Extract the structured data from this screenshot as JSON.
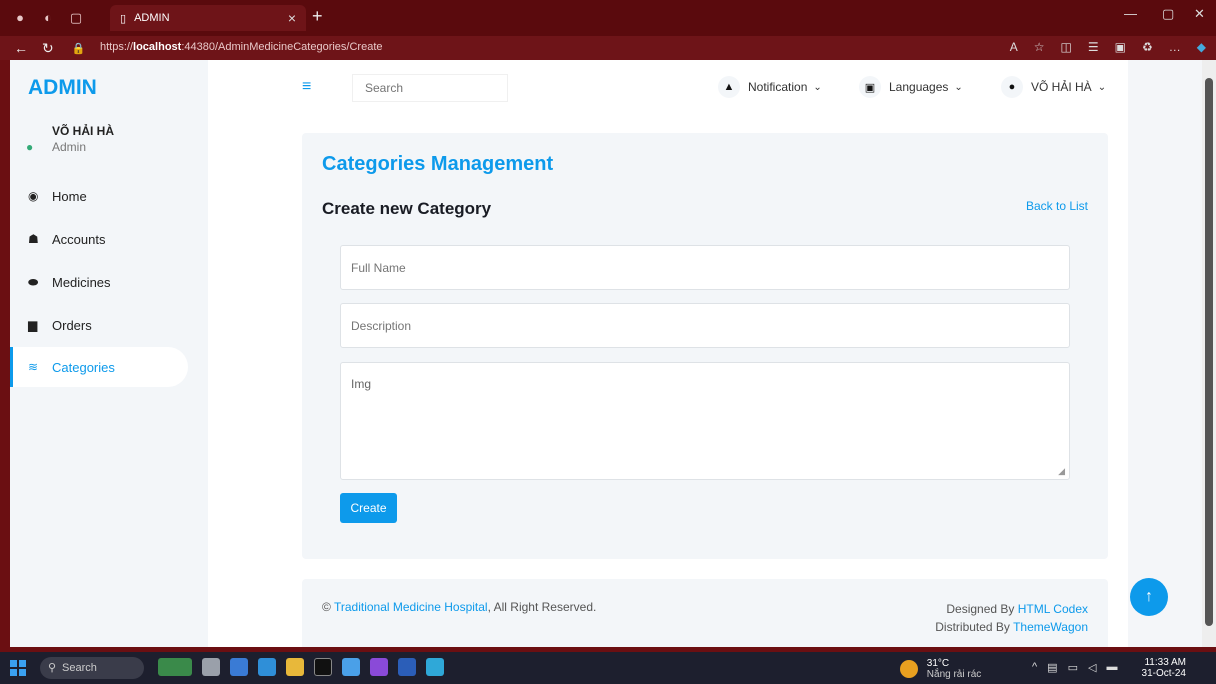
{
  "browser": {
    "tab_title": "ADMIN",
    "new_tab": "+",
    "url_prefix": "https://",
    "url_host": "localhost",
    "url_rest": ":44380/AdminMedicineCategories/Create"
  },
  "sidebar": {
    "brand": "ADMIN",
    "user_name": "VÕ HẢI HÀ",
    "user_role": "Admin",
    "items": [
      {
        "label": "Home",
        "icon": "dashboard-icon"
      },
      {
        "label": "Accounts",
        "icon": "users-icon"
      },
      {
        "label": "Medicines",
        "icon": "pills-icon"
      },
      {
        "label": "Orders",
        "icon": "file-icon"
      },
      {
        "label": "Categories",
        "icon": "layers-icon"
      }
    ],
    "active_item": "Categories"
  },
  "topbar": {
    "search_placeholder": "Search",
    "notification_label": "Notification",
    "languages_label": "Languages",
    "user_label": "VÕ HẢI HÀ"
  },
  "card": {
    "title": "Categories Management",
    "subtitle": "Create new Category",
    "back_link": "Back to List",
    "fields": {
      "full_name_placeholder": "Full Name",
      "description_placeholder": "Description",
      "img_placeholder": "Img"
    },
    "create_button": "Create"
  },
  "footer": {
    "copyright_symbol": "©",
    "hospital_link": "Traditional Medicine Hospital",
    "rights": ", All Right Reserved.",
    "designed_by": "Designed By",
    "designer_link": "HTML Codex",
    "distributed_by": "Distributed By",
    "distributor_link": "ThemeWagon"
  },
  "taskbar": {
    "search_label": "Search",
    "weather_temp": "31°C",
    "weather_desc": "Nắng rải rác",
    "time": "11:33 AM",
    "date": "31-Oct-24"
  },
  "colors": {
    "accent": "#0d9aeb",
    "browser_frame": "#6e1418",
    "page_bg": "#f3f6f9"
  }
}
